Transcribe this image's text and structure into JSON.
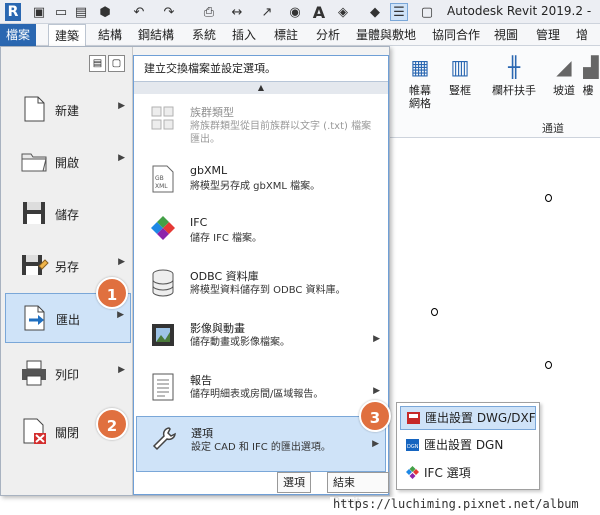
{
  "app": {
    "title": "Autodesk Revit 2019.2 -"
  },
  "tabs": [
    "檔案",
    "建築",
    "結構",
    "鋼結構",
    "系統",
    "插入",
    "標註",
    "分析",
    "量體與敷地",
    "協同合作",
    "視圖",
    "管理",
    "增益"
  ],
  "ribbon": {
    "buttons": [
      "帷幕\n網格",
      "豎框",
      "欄杆扶手",
      "坡道",
      "樓"
    ],
    "panel_label": "通道"
  },
  "menu": {
    "items": [
      {
        "label": "新建",
        "arrow": true
      },
      {
        "label": "開啟",
        "arrow": true
      },
      {
        "label": "儲存",
        "arrow": false
      },
      {
        "label": "另存",
        "arrow": true
      },
      {
        "label": "匯出",
        "arrow": true
      },
      {
        "label": "列印",
        "arrow": true
      },
      {
        "label": "關閉",
        "arrow": false
      }
    ],
    "selected_index": 4
  },
  "export_panel": {
    "header": "建立交換檔案並設定選項。",
    "items": [
      {
        "title": "族群類型",
        "desc": "將族群類型從目前族群以文字 (.txt) 檔案匯出。",
        "arrow": false
      },
      {
        "title": "gbXML",
        "desc": "將模型另存成 gbXML 檔案。",
        "arrow": false
      },
      {
        "title": "IFC",
        "desc": "儲存 IFC 檔案。",
        "arrow": false
      },
      {
        "title": "ODBC 資料庫",
        "desc": "將模型資料儲存到 ODBC 資料庫。",
        "arrow": false
      },
      {
        "title": "影像與動畫",
        "desc": "儲存動畫或影像檔案。",
        "arrow": true
      },
      {
        "title": "報告",
        "desc": "儲存明細表或房間/區域報告。",
        "arrow": true
      },
      {
        "title": "選項",
        "desc": "設定 CAD 和 IFC 的匯出選項。",
        "arrow": true
      }
    ]
  },
  "footer": {
    "options_button": "選項",
    "exit_button": "結束 Revit"
  },
  "flyout": {
    "items": [
      "匯出設置 DWG/DXF",
      "匯出設置 DGN",
      "IFC 選項"
    ]
  },
  "steps": [
    "1",
    "2",
    "3"
  ],
  "watermark": "https://luchiming.pixnet.net/album",
  "colors": {
    "accent": "#2a67b1",
    "badge": "#e0703f",
    "selection": "#cfe3f8"
  }
}
